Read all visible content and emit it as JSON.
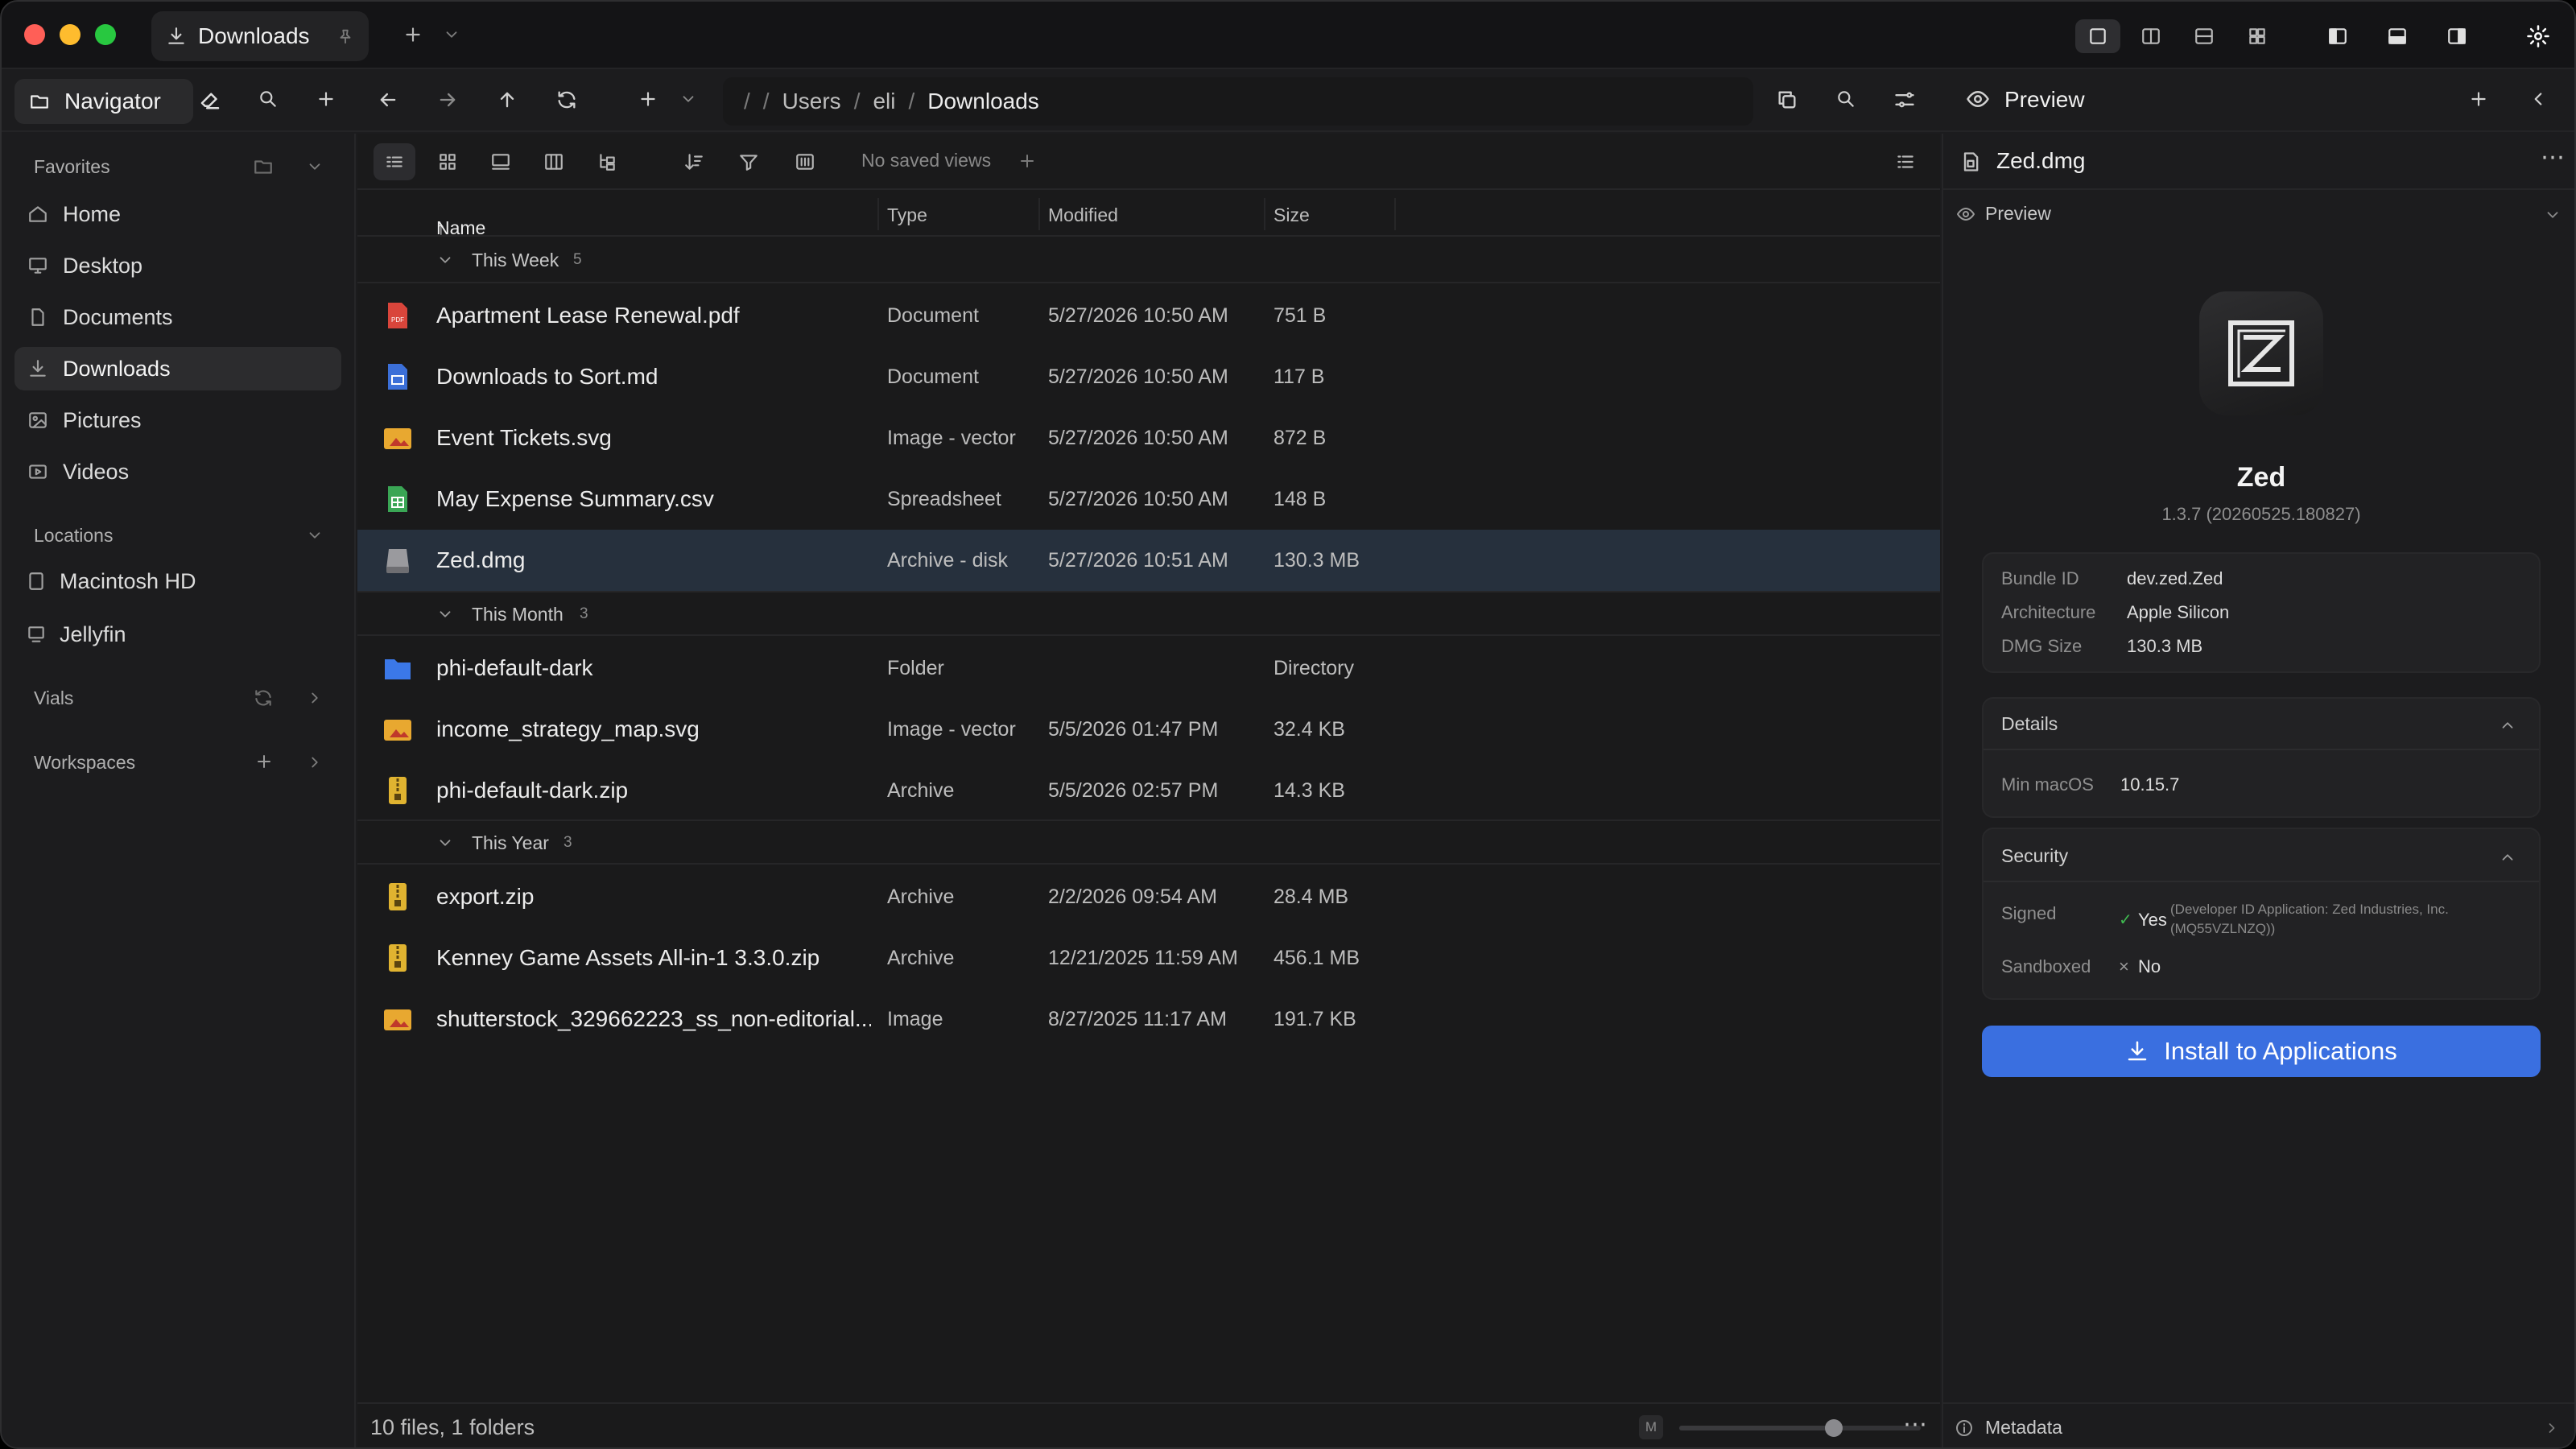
{
  "window": {
    "tab_title": "Downloads",
    "traffic_lights": {
      "close": "#ff5f57",
      "minimize": "#febc2e",
      "zoom": "#28c840"
    }
  },
  "toolbar": {
    "navigator_label": "Navigator",
    "path": [
      "/",
      "Users",
      "eli",
      "Downloads"
    ]
  },
  "sidebar": {
    "favorites_header": "Favorites",
    "favorites": [
      {
        "label": "Home",
        "icon": "home-icon"
      },
      {
        "label": "Desktop",
        "icon": "desktop-icon"
      },
      {
        "label": "Documents",
        "icon": "document-icon"
      },
      {
        "label": "Downloads",
        "icon": "download-icon",
        "active": true
      },
      {
        "label": "Pictures",
        "icon": "picture-icon"
      },
      {
        "label": "Videos",
        "icon": "video-icon"
      }
    ],
    "locations_header": "Locations",
    "locations": [
      {
        "label": "Macintosh HD",
        "icon": "disk-icon"
      },
      {
        "label": "Jellyfin",
        "icon": "server-icon"
      }
    ],
    "vials_header": "Vials",
    "workspaces_header": "Workspaces"
  },
  "main": {
    "saved_views": "No saved views",
    "columns": {
      "name": "Name",
      "type": "Type",
      "modified": "Modified",
      "size": "Size"
    },
    "groups": [
      {
        "label": "This Week",
        "count": "5",
        "files": [
          {
            "name": "Apartment Lease Renewal.pdf",
            "type": "Document",
            "modified": "5/27/2026 10:50 AM",
            "size": "751 B",
            "icon": "pdf-icon"
          },
          {
            "name": "Downloads to Sort.md",
            "type": "Document",
            "modified": "5/27/2026 10:50 AM",
            "size": "117 B",
            "icon": "markdown-icon"
          },
          {
            "name": "Event Tickets.svg",
            "type": "Image - vector",
            "modified": "5/27/2026 10:50 AM",
            "size": "872 B",
            "icon": "image-icon"
          },
          {
            "name": "May Expense Summary.csv",
            "type": "Spreadsheet",
            "modified": "5/27/2026 10:50 AM",
            "size": "148 B",
            "icon": "spreadsheet-icon"
          },
          {
            "name": "Zed.dmg",
            "type": "Archive - disk",
            "modified": "5/27/2026 10:51 AM",
            "size": "130.3 MB",
            "icon": "disk-image-icon",
            "selected": true
          }
        ]
      },
      {
        "label": "This Month",
        "count": "3",
        "files": [
          {
            "name": "phi-default-dark",
            "type": "Folder",
            "modified": "",
            "size": "Directory",
            "icon": "folder-icon"
          },
          {
            "name": "income_strategy_map.svg",
            "type": "Image - vector",
            "modified": "5/5/2026 01:47 PM",
            "size": "32.4 KB",
            "icon": "image-icon"
          },
          {
            "name": "phi-default-dark.zip",
            "type": "Archive",
            "modified": "5/5/2026 02:57 PM",
            "size": "14.3 KB",
            "icon": "zip-icon"
          }
        ]
      },
      {
        "label": "This Year",
        "count": "3",
        "files": [
          {
            "name": "export.zip",
            "type": "Archive",
            "modified": "2/2/2026 09:54 AM",
            "size": "28.4 MB",
            "icon": "zip-icon"
          },
          {
            "name": "Kenney Game Assets All-in-1 3.3.0.zip",
            "type": "Archive",
            "modified": "12/21/2025 11:59 AM",
            "size": "456.1 MB",
            "icon": "zip-icon"
          },
          {
            "name": "shutterstock_329662223_ss_non-editorial...",
            "type": "Image",
            "modified": "8/27/2025 11:17 AM",
            "size": "191.7 KB",
            "icon": "image-icon"
          }
        ]
      }
    ],
    "status_text": "10 files, 1 folders",
    "zoom_badge": "M",
    "zoom_level": 0.65
  },
  "preview": {
    "header_label": "Preview",
    "file_name": "Zed.dmg",
    "section_label": "Preview",
    "app_name": "Zed",
    "app_version": "1.3.7 (20260525.180827)",
    "info": [
      {
        "key": "Bundle ID",
        "value": "dev.zed.Zed"
      },
      {
        "key": "Architecture",
        "value": "Apple Silicon"
      },
      {
        "key": "DMG Size",
        "value": "130.3 MB"
      }
    ],
    "details_header": "Details",
    "details": [
      {
        "key": "Min macOS",
        "value": "10.15.7"
      }
    ],
    "security_header": "Security",
    "signed_key": "Signed",
    "signed_value": "Yes",
    "signed_detail_1": "(Developer ID Application: Zed Industries, Inc.",
    "signed_detail_2": "(MQ55VZLNZQ))",
    "sandboxed_key": "Sandboxed",
    "sandboxed_value": "No",
    "install_label": "Install to Applications",
    "metadata_label": "Metadata"
  },
  "colors": {
    "accent": "#3a6fe0",
    "selection": "#26303d",
    "background": "#1c1c1e"
  }
}
